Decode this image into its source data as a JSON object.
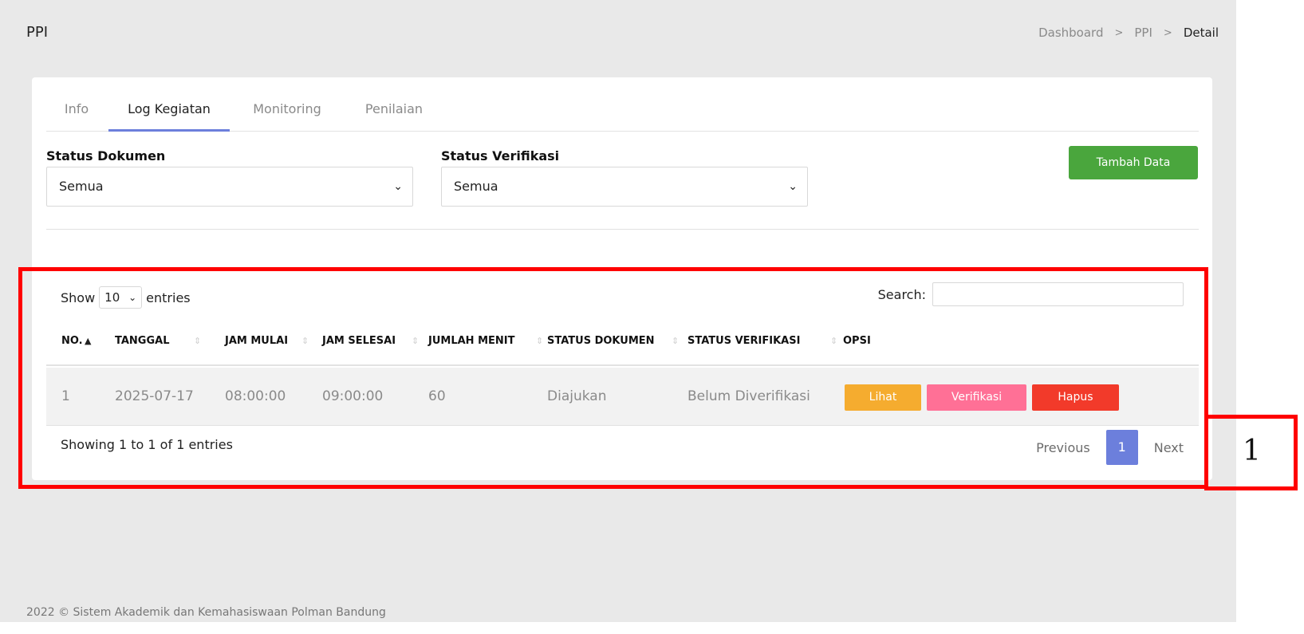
{
  "header": {
    "title": "PPI",
    "breadcrumb": [
      "Dashboard",
      "PPI",
      "Detail"
    ],
    "breadcrumb_sep": ">"
  },
  "tabs": [
    "Info",
    "Log Kegiatan",
    "Monitoring",
    "Penilaian"
  ],
  "filters": {
    "status_dokumen_label": "Status Dokumen",
    "status_dokumen_value": "Semua",
    "status_verifikasi_label": "Status Verifikasi",
    "status_verifikasi_value": "Semua"
  },
  "add_button": "Tambah Data",
  "table": {
    "show": "Show",
    "entries_value": "10",
    "entries": "entries",
    "search_label": "Search:",
    "columns": [
      "NO.",
      "TANGGAL",
      "JAM MULAI",
      "JAM SELESAI",
      "JUMLAH MENIT",
      "STATUS DOKUMEN",
      "STATUS VERIFIKASI",
      "OPSI"
    ],
    "rows": [
      {
        "no": "1",
        "tanggal": "2025-07-17",
        "jam_mulai": "08:00:00",
        "jam_selesai": "09:00:00",
        "jumlah_menit": "60",
        "status_dokumen": "Diajukan",
        "status_verifikasi": "Belum Diverifikasi",
        "actions": [
          "Lihat",
          "Verifikasi",
          "Hapus"
        ]
      }
    ],
    "info": "Showing 1 to 1 of 1 entries",
    "pager": {
      "previous": "Previous",
      "page": "1",
      "next": "Next"
    }
  },
  "footer": "2022 © Sistem Akademik dan Kemahasiswaan Polman Bandung",
  "annotation_marker": "1",
  "colors": {
    "accent": "#6c7fdc",
    "add_button": "#4aa63d",
    "lihat": "#f5ac2f",
    "verifikasi": "#ff7096",
    "hapus": "#f23a2a",
    "highlight_box": "#ff0000"
  },
  "icons": {
    "select_chevron": "chevron-down-icon",
    "sort_icon": "sort-icon",
    "sort_asc_icon": "sort-asc-icon",
    "breadcrumb_sep": "chevron-right-icon"
  }
}
